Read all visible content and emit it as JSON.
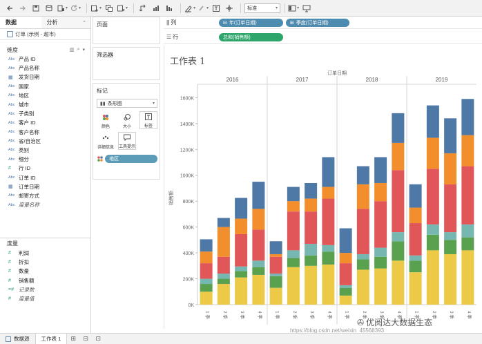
{
  "toolbar": {
    "icons": [
      "undo-icon",
      "redo-icon",
      "save-icon",
      "new-datasource-icon",
      "pause-icon",
      "refresh-icon",
      "new-sheet-icon",
      "duplicate-icon",
      "clear-icon",
      "swap-icon",
      "sort-asc-icon",
      "sort-desc-icon",
      "highlight-icon",
      "group-icon",
      "label-icon",
      "fix-axes-icon",
      "fit-icon",
      "show-cards-icon",
      "presentation-icon"
    ],
    "fit_select": "标准"
  },
  "datapane": {
    "tabs": [
      "数据",
      "分析"
    ],
    "datasource": "订单 (示例 - 超市)",
    "dimensions_header": "维度",
    "dimensions": [
      {
        "type": "Abc",
        "name": "产品 ID"
      },
      {
        "type": "Abc",
        "name": "产品名称"
      },
      {
        "type": "date",
        "name": "发货日期"
      },
      {
        "type": "Abc",
        "name": "国家"
      },
      {
        "type": "Abc",
        "name": "地区"
      },
      {
        "type": "Abc",
        "name": "城市"
      },
      {
        "type": "Abc",
        "name": "子类别"
      },
      {
        "type": "Abc",
        "name": "客户 ID"
      },
      {
        "type": "Abc",
        "name": "客户名称"
      },
      {
        "type": "Abc",
        "name": "省/自治区"
      },
      {
        "type": "Abc",
        "name": "类别"
      },
      {
        "type": "Abc",
        "name": "细分"
      },
      {
        "type": "#",
        "name": "行 ID"
      },
      {
        "type": "Abc",
        "name": "订单 ID"
      },
      {
        "type": "date",
        "name": "订单日期"
      },
      {
        "type": "Abc",
        "name": "邮寄方式"
      },
      {
        "type": "Abc",
        "name": "度量名称"
      }
    ],
    "measures_header": "度量",
    "measures": [
      {
        "type": "#",
        "name": "利润"
      },
      {
        "type": "#",
        "name": "折扣"
      },
      {
        "type": "#",
        "name": "数量"
      },
      {
        "type": "#",
        "name": "销售额"
      },
      {
        "type": "=#",
        "name": "记录数"
      },
      {
        "type": "#",
        "name": "度量值"
      }
    ]
  },
  "cards": {
    "pages": "页面",
    "filters": "筛选器",
    "marks": "标记",
    "mark_type": "条形图",
    "buttons": [
      "颜色",
      "大小",
      "标签",
      "详细信息",
      "工具提示"
    ],
    "color_pill": "地区"
  },
  "shelves": {
    "columns_label": "列",
    "rows_label": "行",
    "columns": [
      "年(订单日期)",
      "季度(订单日期)"
    ],
    "rows": [
      "总和(销售额)"
    ]
  },
  "sheet": {
    "title": "工作表 1"
  },
  "chart_data": {
    "type": "bar",
    "stacked": true,
    "header_title": "订单日期",
    "years": [
      "2016",
      "2017",
      "2018",
      "2019"
    ],
    "quarters": [
      "1 季",
      "2 季",
      "3 季",
      "4 季"
    ],
    "ylabel": "销售额",
    "ylim": [
      0,
      1650000
    ],
    "yticks": [
      0,
      200000,
      400000,
      600000,
      800000,
      1000000,
      1200000,
      1400000,
      1600000
    ],
    "ytick_labels": [
      "0K",
      "200K",
      "400K",
      "600K",
      "800K",
      "1000K",
      "1200K",
      "1400K",
      "1600K"
    ],
    "series_order_bottom_to_top": [
      "yellow",
      "green",
      "teal",
      "red",
      "orange",
      "blue"
    ],
    "colors": [
      "#edc948",
      "#59a14f",
      "#76b7b2",
      "#e15759",
      "#f28e2b",
      "#4e79a7"
    ],
    "stacks": [
      [
        [
          100000,
          60000,
          40000,
          120000,
          90000,
          95000
        ],
        [
          160000,
          40000,
          40000,
          130000,
          230000,
          70000
        ],
        [
          210000,
          50000,
          35000,
          250000,
          120000,
          160000
        ],
        [
          230000,
          60000,
          50000,
          240000,
          160000,
          210000
        ]
      ],
      [
        [
          130000,
          90000,
          20000,
          130000,
          20000,
          100000
        ],
        [
          290000,
          70000,
          60000,
          300000,
          80000,
          110000
        ],
        [
          300000,
          80000,
          90000,
          250000,
          100000,
          120000
        ],
        [
          310000,
          100000,
          50000,
          360000,
          90000,
          230000
        ]
      ],
      [
        [
          70000,
          60000,
          20000,
          170000,
          80000,
          190000
        ],
        [
          270000,
          80000,
          40000,
          350000,
          190000,
          140000
        ],
        [
          280000,
          90000,
          70000,
          360000,
          140000,
          200000
        ],
        [
          340000,
          150000,
          70000,
          480000,
          210000,
          230000
        ]
      ],
      [
        [
          250000,
          90000,
          40000,
          250000,
          120000,
          180000
        ],
        [
          420000,
          120000,
          80000,
          430000,
          240000,
          250000
        ],
        [
          390000,
          110000,
          60000,
          370000,
          240000,
          270000
        ],
        [
          420000,
          100000,
          100000,
          450000,
          240000,
          280000
        ]
      ]
    ]
  },
  "bottom": {
    "datasource_tab": "数据源",
    "sheet_tab": "工作表 1"
  },
  "watermark": {
    "text": "优阅达大数据生态",
    "url": "https://blog.csdn.net/weixin_45568393"
  }
}
